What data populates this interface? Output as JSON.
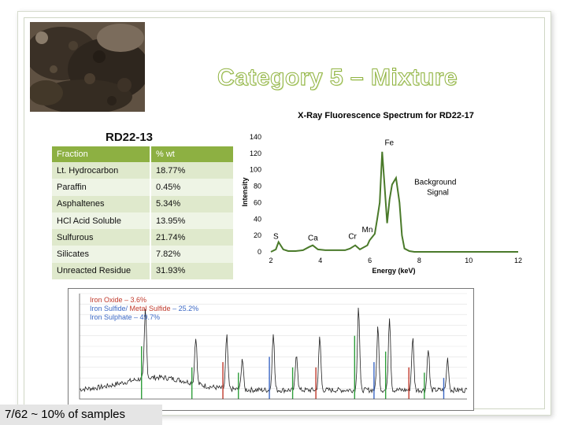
{
  "title": "Category 5 – Mixture",
  "sample_label": "RD22-13",
  "table": {
    "headers": [
      "Fraction",
      "% wt"
    ],
    "rows": [
      {
        "fraction": "Lt. Hydrocarbon",
        "wt": "18.77%"
      },
      {
        "fraction": "Paraffin",
        "wt": "0.45%"
      },
      {
        "fraction": "Asphaltenes",
        "wt": "5.34%"
      },
      {
        "fraction": "HCl Acid Soluble",
        "wt": "13.95%"
      },
      {
        "fraction": "Sulfurous",
        "wt": "21.74%"
      },
      {
        "fraction": "Silicates",
        "wt": "7.82%"
      },
      {
        "fraction": "Unreacted Residue",
        "wt": "31.93%"
      }
    ]
  },
  "xrd_legend": [
    {
      "text": "Iron Oxide – 3.6%",
      "color": "#c0392b"
    },
    {
      "parts": [
        {
          "text": "Iron Sulfide/ ",
          "color": "#3a67c4"
        },
        {
          "text": "Metal Sulfide",
          "color": "#c0392b"
        },
        {
          "text": " – 25.2%",
          "color": "#3a67c4"
        }
      ]
    },
    {
      "text": "Iron Sulphate – 49.7%",
      "color": "#3a67c4"
    }
  ],
  "footer_text": "7/62 ~ 10% of samples",
  "colors": {
    "accent": "#8db042",
    "row_odd": "#dfe9cc",
    "row_even": "#eef4e5"
  },
  "chart_data": [
    {
      "type": "line",
      "title": "X-Ray Fluorescence Spectrum for RD22-17",
      "xlabel": "Energy (keV)",
      "ylabel": "Intensity",
      "xlim": [
        2,
        12
      ],
      "ylim": [
        0,
        140
      ],
      "x_ticks": [
        "2",
        "4",
        "6",
        "8",
        "10",
        "12"
      ],
      "y_ticks": [
        "0",
        "20",
        "40",
        "60",
        "80",
        "100",
        "120",
        "140"
      ],
      "grid": false,
      "series": [
        {
          "x": [
            2.0,
            2.2,
            2.31,
            2.5,
            2.7,
            3.0,
            3.3,
            3.55,
            3.69,
            3.9,
            4.2,
            4.6,
            5.0,
            5.2,
            5.41,
            5.6,
            5.9,
            5.99,
            6.2,
            6.3,
            6.4,
            6.5,
            6.6,
            6.7,
            6.8,
            6.9,
            7.06,
            7.2,
            7.3,
            7.4,
            7.6,
            7.8,
            8.0,
            12.0
          ],
          "y": [
            0,
            3,
            12,
            3,
            1,
            1,
            2,
            6,
            8,
            3,
            2,
            2,
            2,
            4,
            8,
            3,
            8,
            14,
            22,
            40,
            60,
            122,
            80,
            35,
            64,
            82,
            90,
            60,
            20,
            4,
            1,
            0,
            0,
            0
          ]
        }
      ],
      "annotations": [
        "Fe",
        "Background Signal",
        "S",
        "Ca",
        "Cr",
        "Mn"
      ]
    },
    {
      "type": "line",
      "xlabel": "",
      "ylabel": "",
      "series": [
        {
          "x": [
            0,
            0.05,
            0.1,
            0.15,
            0.2,
            0.25,
            0.3,
            0.35,
            0.4,
            0.45,
            0.5,
            0.55,
            0.6,
            0.65,
            0.7,
            0.75,
            0.8,
            0.85,
            0.9,
            0.95,
            1.0
          ],
          "y": [
            0.05,
            0.08,
            0.1,
            0.2,
            0.4,
            0.25,
            0.15,
            0.3,
            0.2,
            0.6,
            0.35,
            0.2,
            0.3,
            0.15,
            0.55,
            0.2,
            0.3,
            0.25,
            0.4,
            0.3,
            0.1
          ]
        }
      ]
    }
  ]
}
